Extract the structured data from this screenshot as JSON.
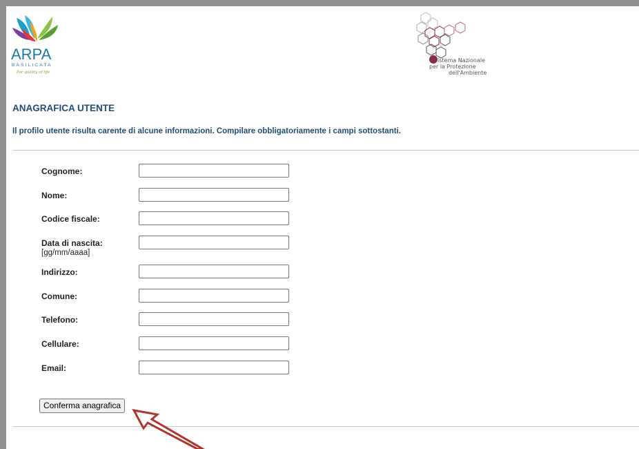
{
  "header": {
    "arpa_logo": {
      "name": "ARPA",
      "sub": "BASILICATA",
      "tagline": "For quality of life"
    },
    "snpa_logo": {
      "line1": "istema Nazionale",
      "line2": "per la Protezione",
      "line3": "dell'Ambiente"
    }
  },
  "page": {
    "title": "ANAGRAFICA UTENTE",
    "notice": "Il profilo utente risulta carente di alcune informazioni. Compilare obbligatoriamente i campi sottostanti."
  },
  "form": {
    "fields": [
      {
        "label": "Cognome:",
        "value": ""
      },
      {
        "label": "Nome:",
        "value": ""
      },
      {
        "label": "Codice fiscale:",
        "value": ""
      },
      {
        "label": "Data di nascita:",
        "hint": "[gg/mm/aaaa]",
        "value": ""
      },
      {
        "label": "Indirizzo:",
        "value": ""
      },
      {
        "label": "Comune:",
        "value": ""
      },
      {
        "label": "Telefono:",
        "value": ""
      },
      {
        "label": "Cellulare:",
        "value": ""
      },
      {
        "label": "Email:",
        "value": ""
      }
    ],
    "submit_label": "Conferma anagrafica"
  },
  "colors": {
    "heading": "#1f4e79",
    "arrow": "#b0352d"
  }
}
